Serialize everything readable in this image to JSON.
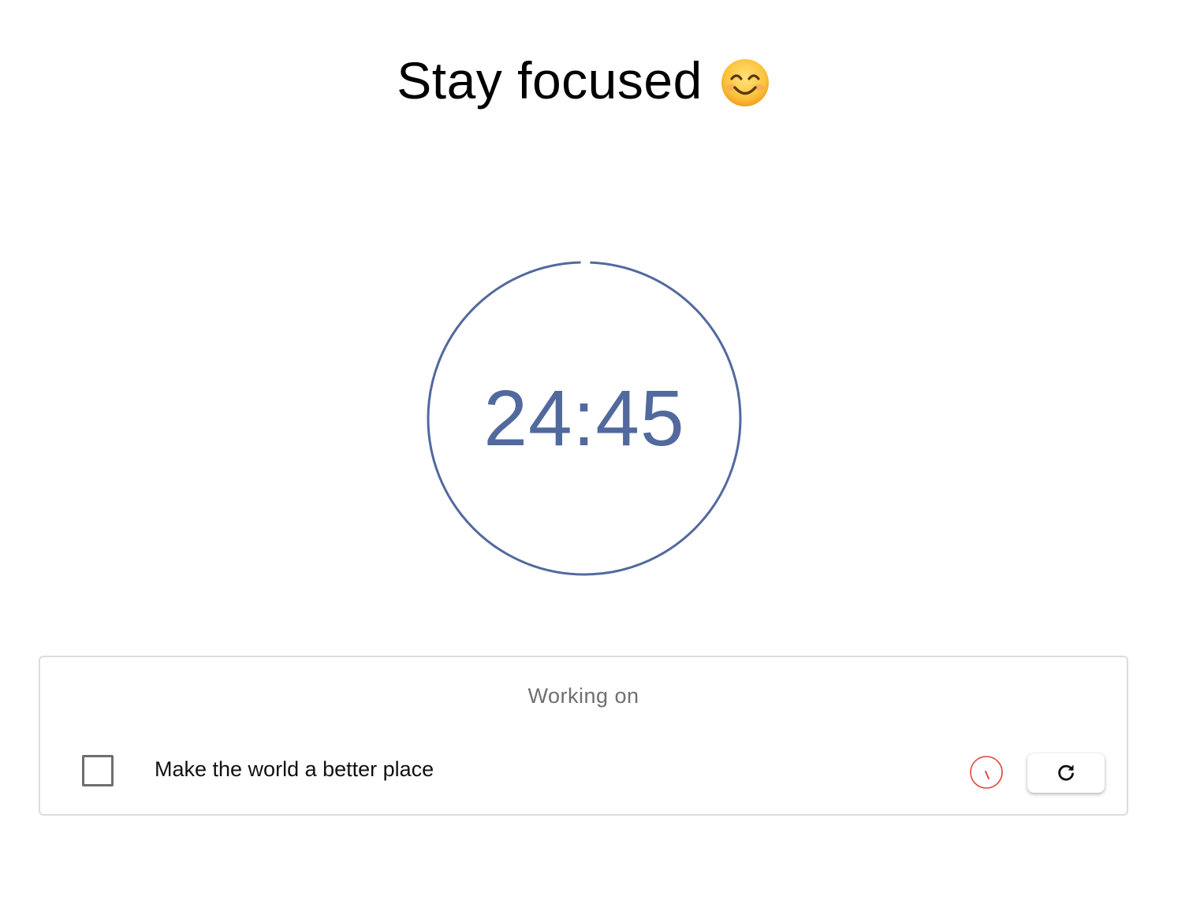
{
  "header": {
    "title": "Stay focused",
    "emoji": "smiling-face-emoji"
  },
  "timer": {
    "time": "24:45",
    "progress": 0.99,
    "color": "#52699e"
  },
  "task_card": {
    "title": "Working on",
    "task": {
      "label": "Make the world a better place",
      "checked": false
    },
    "mini_timer_color": "#e0463c",
    "reset_icon": "refresh-icon"
  }
}
